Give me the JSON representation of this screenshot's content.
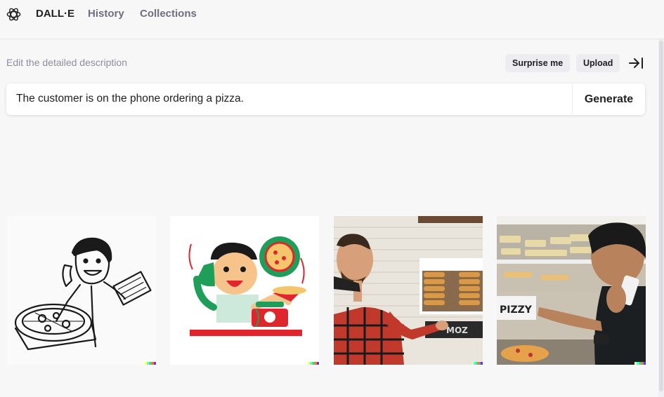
{
  "nav": {
    "brand": "DALL·E",
    "history": "History",
    "collections": "Collections"
  },
  "editor": {
    "hint": "Edit the detailed description",
    "surprise_label": "Surprise me",
    "upload_label": "Upload",
    "prompt_value": "The customer is on the phone ordering a pizza.",
    "generate_label": "Generate"
  },
  "images": {
    "sign_text": "PIZZY",
    "oven_text": "MOZ"
  },
  "colors": {
    "background": "#f7f7f8",
    "pill": "#ececf1",
    "text": "#202123",
    "muted": "#8e8ea0",
    "nav_inactive": "#6e6e80"
  },
  "icons": {
    "logo": "openai-logo-icon",
    "collapse": "collapse-panel-icon"
  }
}
